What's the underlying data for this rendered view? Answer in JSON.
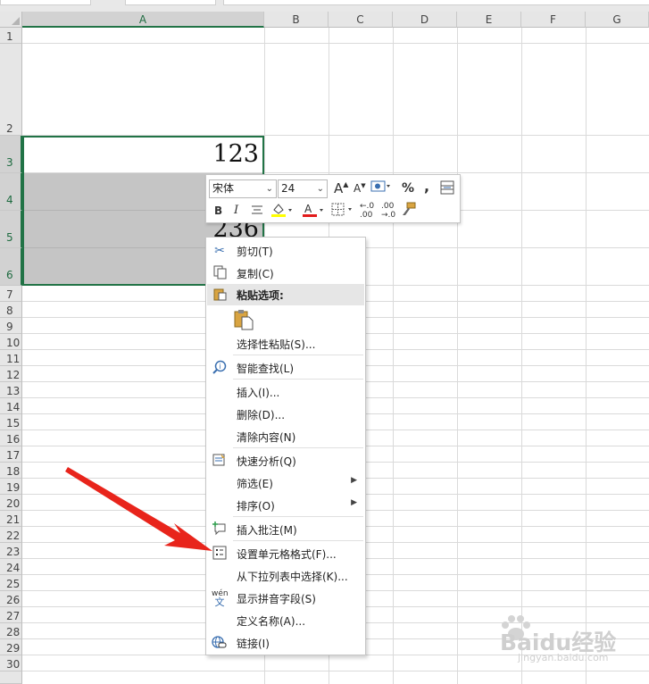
{
  "columns": [
    "A",
    "B",
    "C",
    "D",
    "E",
    "F",
    "G"
  ],
  "rows": [
    "1",
    "2",
    "3",
    "4",
    "5",
    "6",
    "7",
    "8",
    "9",
    "10",
    "11",
    "12",
    "13",
    "14",
    "15",
    "16",
    "17",
    "18",
    "19",
    "20",
    "21",
    "22",
    "23",
    "24",
    "25",
    "26",
    "27",
    "28",
    "29",
    "30"
  ],
  "cells": {
    "a3": "123",
    "a5": "236"
  },
  "mini_toolbar": {
    "font_name": "宋体",
    "font_size": "24",
    "percent": "%",
    "comma": ",",
    "bold": "B",
    "italic": "I"
  },
  "context_menu": {
    "cut": "剪切(T)",
    "copy": "复制(C)",
    "paste_options": "粘贴选项:",
    "paste_special": "选择性粘贴(S)...",
    "smart_lookup": "智能查找(L)",
    "insert": "插入(I)...",
    "delete": "删除(D)...",
    "clear_contents": "清除内容(N)",
    "quick_analysis": "快速分析(Q)",
    "filter": "筛选(E)",
    "sort": "排序(O)",
    "insert_comment": "插入批注(M)",
    "format_cells": "设置单元格格式(F)...",
    "pick_from_list": "从下拉列表中选择(K)...",
    "phonetic": "显示拼音字段(S)",
    "define_name": "定义名称(A)...",
    "link": "链接(I)"
  },
  "watermark": {
    "brand": "Baidu经验",
    "url": "jingyan.baidu.com"
  },
  "colors": {
    "accent": "#217346",
    "arrow": "#e8241b"
  }
}
